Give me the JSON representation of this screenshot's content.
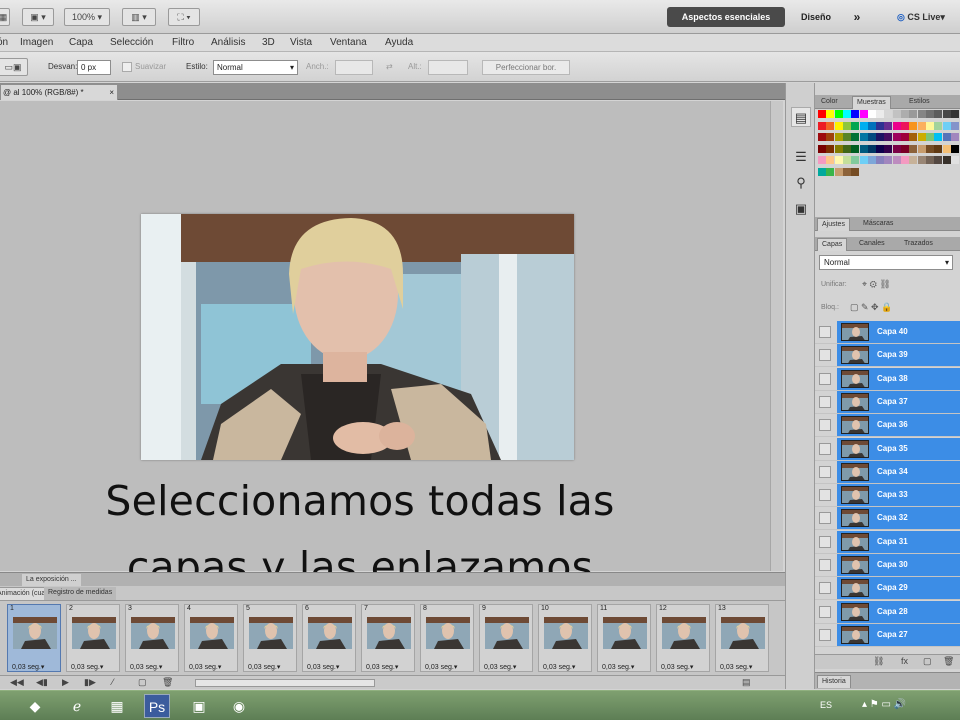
{
  "appbar": {
    "zoom": "100%",
    "workspace_active": "Aspectos esenciales",
    "workspace_other": "Diseño",
    "more": "»",
    "cs_live": "CS Live"
  },
  "menu": [
    "Imagen",
    "Capa",
    "Selección",
    "Filtro",
    "Análisis",
    "3D",
    "Vista",
    "Ventana",
    "Ayuda"
  ],
  "options": {
    "desv_label": "Desvan:",
    "desv_value": "0 px",
    "suavizar": "Suavizar",
    "estilo_label": "Estilo:",
    "estilo_value": "Normal",
    "anch_label": "Anch.:",
    "alt_label": "Alt.:",
    "refine_button": "Perfeccionar bor."
  },
  "document": {
    "tab": "@ al 100% (RGB/8#) *",
    "close": "×"
  },
  "caption": {
    "line1": "Seleccionamos todas las",
    "line2": "capas y las enlazamos"
  },
  "timeline": {
    "tab1": "La exposición ...",
    "anim_tab": "Animación (cuadros)",
    "log_tab": "Registro de medidas",
    "frames": [
      {
        "num": "1",
        "delay": "0,03 seg."
      },
      {
        "num": "2",
        "delay": "0,03 seg."
      },
      {
        "num": "3",
        "delay": "0,03 seg."
      },
      {
        "num": "4",
        "delay": "0,03 seg."
      },
      {
        "num": "5",
        "delay": "0,03 seg."
      },
      {
        "num": "6",
        "delay": "0,03 seg."
      },
      {
        "num": "7",
        "delay": "0,03 seg."
      },
      {
        "num": "8",
        "delay": "0,03 seg."
      },
      {
        "num": "9",
        "delay": "0,03 seg."
      },
      {
        "num": "10",
        "delay": "0,03 seg."
      },
      {
        "num": "11",
        "delay": "0,03 seg."
      },
      {
        "num": "12",
        "delay": "0,03 seg."
      },
      {
        "num": "13",
        "delay": "0,03 seg."
      }
    ]
  },
  "panels": {
    "color_tabs": [
      "Color",
      "Muestras",
      "Estilos"
    ],
    "adjust_tabs": [
      "Ajustes",
      "Máscaras"
    ],
    "layer_tabs": [
      "Capas",
      "Canales",
      "Trazados"
    ],
    "blend_mode": "Normal",
    "unify_label": "Unificar:",
    "lock_label": "Bloq.:",
    "history_tab": "Historia"
  },
  "layers": [
    "Capa 40",
    "Capa 39",
    "Capa 38",
    "Capa 37",
    "Capa 36",
    "Capa 35",
    "Capa 34",
    "Capa 33",
    "Capa 32",
    "Capa 31",
    "Capa 30",
    "Capa 29",
    "Capa 28",
    "Capa 27"
  ],
  "taskbar": {
    "lang": "ES"
  },
  "colors": {
    "selection": "#3c8de6",
    "workspace_btn": "#4a4a4a"
  }
}
